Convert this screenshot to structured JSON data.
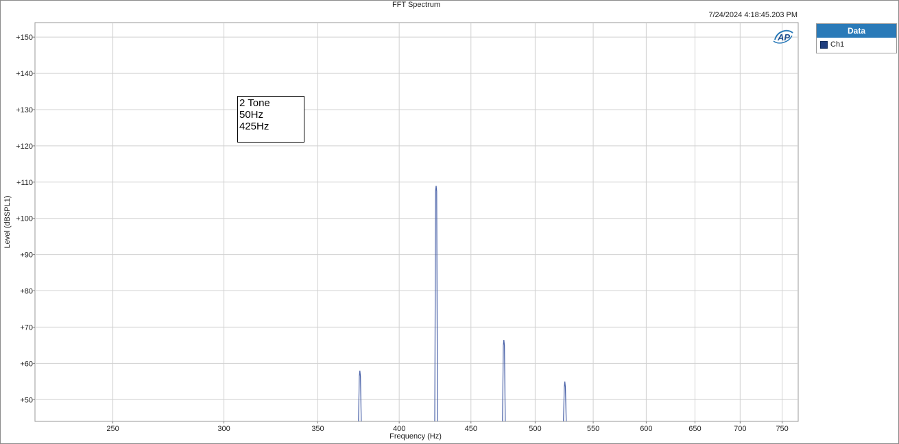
{
  "chart_data": {
    "type": "line",
    "title": "FFT Spectrum",
    "timestamp": "7/24/2024 4:18:45.203 PM",
    "xlabel": "Frequency (Hz)",
    "ylabel": "Level (dBSPL1)",
    "xscale": "log",
    "xlim": [
      220,
      770
    ],
    "ylim": [
      44,
      154
    ],
    "xticks": [
      250,
      300,
      350,
      400,
      450,
      500,
      550,
      600,
      650,
      700,
      750
    ],
    "xtick_labels": [
      "250",
      "300",
      "350",
      "400",
      "450",
      "500",
      "550",
      "600",
      "650",
      "700",
      "750"
    ],
    "yticks": [
      50,
      60,
      70,
      80,
      90,
      100,
      110,
      120,
      130,
      140,
      150
    ],
    "ytick_labels": [
      "+50",
      "+60",
      "+70",
      "+80",
      "+90",
      "+100",
      "+110",
      "+120",
      "+130",
      "+140",
      "+150"
    ],
    "grid": true,
    "legend_title": "Data",
    "legend_position": "right",
    "series": [
      {
        "name": "Ch1",
        "color": "#4a62a8",
        "peaks": [
          {
            "x": 375,
            "y": 58
          },
          {
            "x": 425,
            "y": 109
          },
          {
            "x": 475,
            "y": 66.5
          },
          {
            "x": 525,
            "y": 55
          }
        ]
      }
    ],
    "annotation": [
      "2 Tone",
      "50Hz",
      "425Hz"
    ]
  },
  "legend_swatch_color": "#1f3f7f",
  "logo_text": "AP"
}
